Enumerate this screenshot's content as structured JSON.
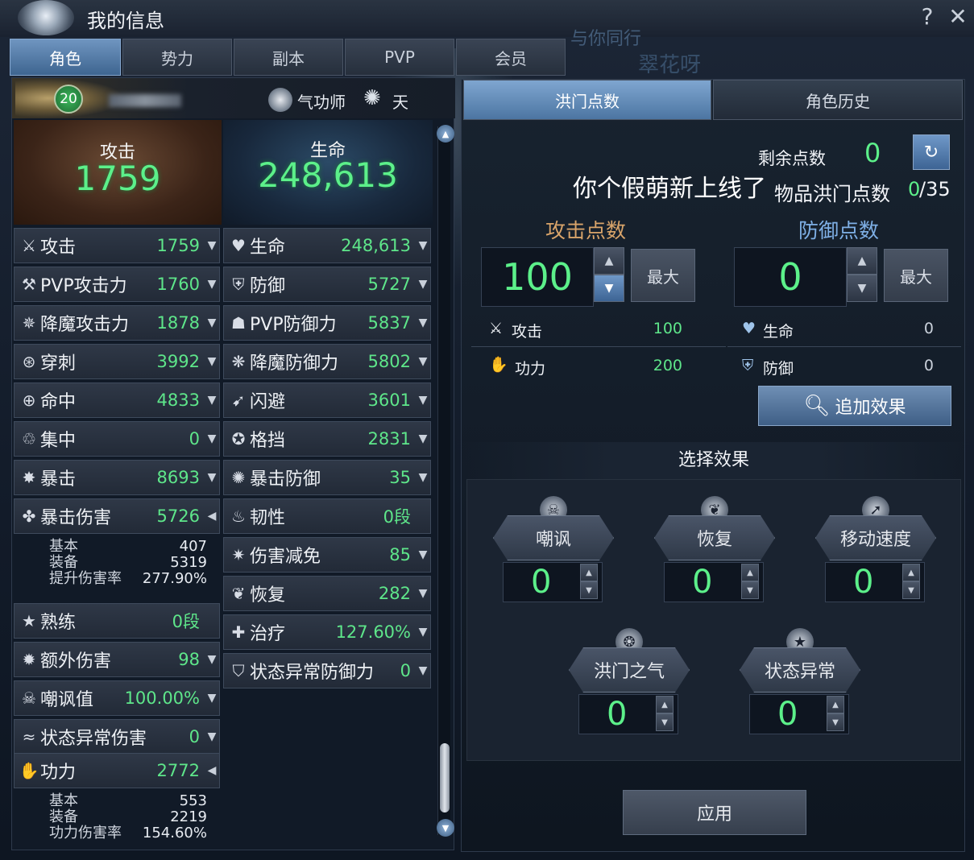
{
  "window": {
    "title": "我的信息",
    "help_label": "?",
    "close_label": "✕",
    "bg_text1": "与你同行",
    "bg_text2": "翠花呀"
  },
  "tabs": [
    {
      "label": "角色",
      "active": true
    },
    {
      "label": "势力"
    },
    {
      "label": "副本"
    },
    {
      "label": "PVP"
    },
    {
      "label": "会员"
    }
  ],
  "character": {
    "level": "20",
    "class": "气功师",
    "faction": "天"
  },
  "summary": {
    "attack_label": "攻击",
    "attack_value": "1759",
    "hp_label": "生命",
    "hp_value": "248,613"
  },
  "left_stats": [
    {
      "icon": "sword-icon",
      "name": "攻击",
      "value": "1759",
      "arrow": "▼"
    },
    {
      "icon": "pvp-attack-icon",
      "name": "PVP攻击力",
      "value": "1760",
      "arrow": "▼"
    },
    {
      "icon": "demon-attack-icon",
      "name": "降魔攻击力",
      "value": "1878",
      "arrow": "▼"
    },
    {
      "icon": "pierce-icon",
      "name": "穿刺",
      "value": "3992",
      "arrow": "▼"
    },
    {
      "icon": "target-icon",
      "name": "命中",
      "value": "4833",
      "arrow": "▼"
    },
    {
      "icon": "focus-icon",
      "name": "集中",
      "value": "0",
      "arrow": "▼"
    },
    {
      "icon": "critical-icon",
      "name": "暴击",
      "value": "8693",
      "arrow": "▼"
    },
    {
      "icon": "crit-damage-icon",
      "name": "暴击伤害",
      "value": "5726",
      "arrow": "◀"
    },
    {
      "icon": "mastery-icon",
      "name": "熟练",
      "value": "0段",
      "arrow": ""
    },
    {
      "icon": "extra-damage-icon",
      "name": "额外伤害",
      "value": "98",
      "arrow": "▼"
    },
    {
      "icon": "skull-icon",
      "name": "嘲讽值",
      "value": "100.00%",
      "arrow": "▼"
    },
    {
      "icon": "status-damage-icon",
      "name": "状态异常伤害",
      "value": "0",
      "arrow": "▼"
    },
    {
      "icon": "power-icon",
      "name": "功力",
      "value": "2772",
      "arrow": "◀"
    }
  ],
  "crit_damage_detail": [
    {
      "label": "基本",
      "value": "407"
    },
    {
      "label": "装备",
      "value": "5319"
    },
    {
      "label": "提升伤害率",
      "value": "277.90%"
    }
  ],
  "power_detail": [
    {
      "label": "基本",
      "value": "553"
    },
    {
      "label": "装备",
      "value": "2219"
    },
    {
      "label": "功力伤害率",
      "value": "154.60%"
    }
  ],
  "right_stats": [
    {
      "icon": "heart-icon",
      "name": "生命",
      "value": "248,613",
      "arrow": "▼"
    },
    {
      "icon": "shield-icon",
      "name": "防御",
      "value": "5727",
      "arrow": "▼"
    },
    {
      "icon": "pvp-defense-icon",
      "name": "PVP防御力",
      "value": "5837",
      "arrow": "▼"
    },
    {
      "icon": "demon-defense-icon",
      "name": "降魔防御力",
      "value": "5802",
      "arrow": "▼"
    },
    {
      "icon": "evasion-icon",
      "name": "闪避",
      "value": "3601",
      "arrow": "▼"
    },
    {
      "icon": "block-icon",
      "name": "格挡",
      "value": "2831",
      "arrow": "▼"
    },
    {
      "icon": "crit-defense-icon",
      "name": "暴击防御",
      "value": "35",
      "arrow": "▼"
    },
    {
      "icon": "toughness-icon",
      "name": "韧性",
      "value": "0段",
      "arrow": ""
    },
    {
      "icon": "damage-reduction-icon",
      "name": "伤害减免",
      "value": "85",
      "arrow": "▼"
    },
    {
      "icon": "recovery-icon",
      "name": "恢复",
      "value": "282",
      "arrow": "▼"
    },
    {
      "icon": "heal-icon",
      "name": "治疗",
      "value": "127.60%",
      "arrow": "▼"
    },
    {
      "icon": "status-defense-icon",
      "name": "状态异常防御力",
      "value": "0",
      "arrow": "▼"
    }
  ],
  "panel_tabs": [
    {
      "label": "洪门点数",
      "active": true
    },
    {
      "label": "角色历史"
    }
  ],
  "points": {
    "remaining_label": "剩余点数",
    "remaining_value": "0",
    "message": "你个假萌新上线了",
    "item_label": "物品洪门点数",
    "item_value": "0",
    "item_total": "/35",
    "attack_points_label": "攻击点数",
    "attack_points_value": "100",
    "defense_points_label": "防御点数",
    "defense_points_value": "0",
    "max_label": "最大"
  },
  "point_effects": {
    "attack": [
      {
        "icon": "sword-icon",
        "label": "攻击",
        "value": "100"
      },
      {
        "icon": "power-icon",
        "label": "功力",
        "value": "200"
      }
    ],
    "defense": [
      {
        "icon": "heart-icon",
        "label": "生命",
        "value": "0"
      },
      {
        "icon": "shield-icon",
        "label": "防御",
        "value": "0"
      }
    ]
  },
  "add_effect_label": "追加效果",
  "select_effect_title": "选择效果",
  "effects": [
    {
      "icon": "skull-icon",
      "label": "嘲讽",
      "value": "0"
    },
    {
      "icon": "sprout-icon",
      "label": "恢复",
      "value": "0"
    },
    {
      "icon": "run-icon",
      "label": "移动速度",
      "value": "0"
    },
    {
      "icon": "dragon-icon",
      "label": "洪门之气",
      "value": "0"
    },
    {
      "icon": "star-icon",
      "label": "状态异常",
      "value": "0"
    }
  ],
  "apply_label": "应用"
}
